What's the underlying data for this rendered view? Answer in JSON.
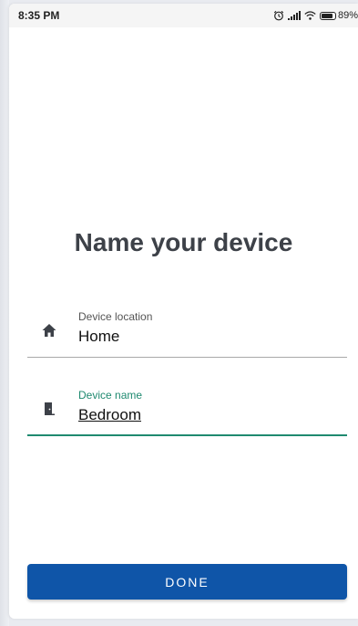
{
  "status_bar": {
    "time": "8:35 PM",
    "battery_text": "89%",
    "battery_level": 0.89,
    "icons": [
      "alarm-icon",
      "signal-icon",
      "wifi-icon",
      "battery-icon"
    ]
  },
  "page": {
    "title": "Name your device"
  },
  "fields": {
    "location": {
      "label": "Device location",
      "value": "Home",
      "icon": "home-icon"
    },
    "name": {
      "label": "Device name",
      "value": "Bedroom",
      "icon": "door-icon"
    }
  },
  "actions": {
    "done_label": "DONE"
  },
  "colors": {
    "accent": "#1f8a70",
    "primary_button": "#0f55a8",
    "title_text": "#3d4148"
  }
}
